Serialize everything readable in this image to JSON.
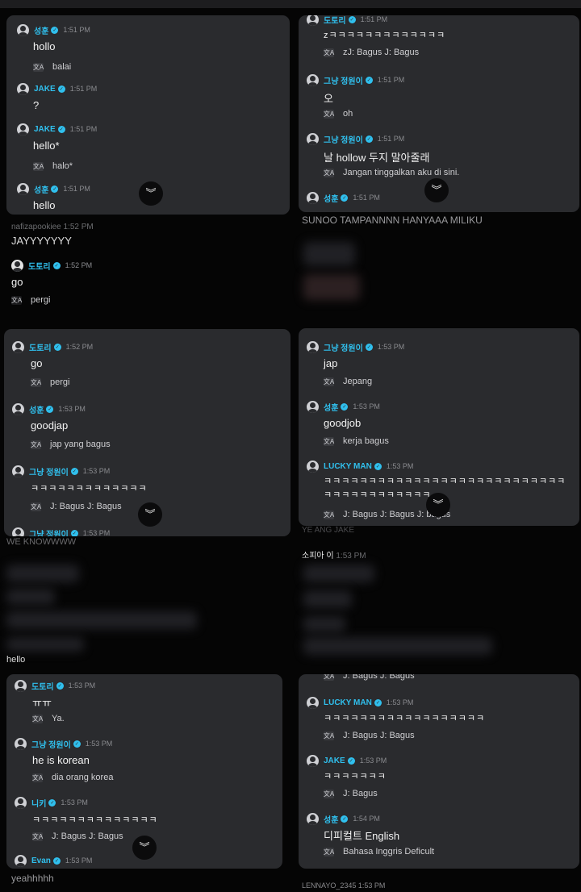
{
  "screenshots": {
    "s1": {
      "messages": [
        {
          "user": "성훈",
          "time": "1:51 PM",
          "text": "hollo",
          "translation": "balai"
        },
        {
          "user": "JAKE",
          "time": "1:51 PM",
          "text": "?"
        },
        {
          "user": "JAKE",
          "time": "1:51 PM",
          "text": "hello*",
          "translation": "halo*"
        },
        {
          "user": "성훈",
          "time": "1:51 PM",
          "text": "hello"
        }
      ],
      "below": {
        "username": "nafizapookiee",
        "time": "1:52 PM",
        "text": "JAYYYYYYY",
        "live_user": "도토리",
        "live_time": "1:52 PM",
        "live_text": "go",
        "live_translation": "pergi"
      }
    },
    "s2": {
      "messages": [
        {
          "user": "도토리",
          "time": "1:51 PM",
          "text": "zㅋㅋㅋㅋㅋㅋㅋㅋㅋㅋㅋㅋㅋ",
          "translation": "zJ: Bagus J: Bagus"
        },
        {
          "user": "그냥 정원이",
          "time": "1:51 PM",
          "text": "오",
          "translation": "oh"
        },
        {
          "user": "그냥 정원이",
          "time": "1:51 PM",
          "text": "날 hollow 두지 말아줄래",
          "translation": "Jangan tinggalkan aku di sini."
        },
        {
          "user": "성훈",
          "time": "1:51 PM"
        }
      ],
      "below": {
        "text": "SUNOO TAMPANNNN HANYAAA MILIKU"
      }
    },
    "s3": {
      "messages": [
        {
          "user": "도토리",
          "time": "1:52 PM",
          "text": "go",
          "translation": "pergi"
        },
        {
          "user": "성훈",
          "time": "1:53 PM",
          "text": "goodjap",
          "translation": "jap yang bagus"
        },
        {
          "user": "그냥 정원이",
          "time": "1:53 PM",
          "text": "ㅋㅋㅋㅋㅋㅋㅋㅋㅋㅋㅋㅋㅋ",
          "translation": "J: Bagus J: Bagus"
        },
        {
          "user": "그냥 정원이",
          "time": "1:53 PM"
        }
      ],
      "below": {
        "text": "WE KNOWWWW",
        "bottom_text": "hello"
      }
    },
    "s4": {
      "messages": [
        {
          "user": "그냥 정원이",
          "time": "1:53 PM",
          "text": "jap",
          "translation": "Jepang"
        },
        {
          "user": "성훈",
          "time": "1:53 PM",
          "text": "goodjob",
          "translation": "kerja bagus"
        },
        {
          "user": "LUCKY MAN",
          "time": "1:53 PM",
          "text": "ㅋㅋㅋㅋㅋㅋㅋㅋㅋㅋㅋㅋㅋㅋㅋㅋㅋㅋㅋㅋㅋㅋㅋㅋㅋㅋㅋㅋㅋㅋㅋㅋㅋㅋㅋㅋㅋㅋㅋ",
          "translation": "J: Bagus J: Bagus J: bagus"
        }
      ],
      "below": {
        "text": "YE ANG JAKE",
        "username": "소피아 이",
        "time": "1:53 PM"
      }
    },
    "s5": {
      "messages": [
        {
          "user": "도토리",
          "time": "1:53 PM",
          "text": "ㅠㅠ",
          "translation": "Ya."
        },
        {
          "user": "그냥 정원이",
          "time": "1:53 PM",
          "text": "he is korean",
          "translation": "dia orang korea"
        },
        {
          "user": "니키",
          "time": "1:53 PM",
          "text": "ㅋㅋㅋㅋㅋㅋㅋㅋㅋㅋㅋㅋㅋㅋ",
          "translation": "J: Bagus J: Bagus"
        },
        {
          "user": "Evan",
          "time": "1:53 PM"
        }
      ],
      "below": {
        "text": "yeahhhhh"
      }
    },
    "s6": {
      "top_translation": "J: Bagus J: Bagus",
      "messages": [
        {
          "user": "LUCKY MAN",
          "time": "1:53 PM",
          "text": "ㅋㅋㅋㅋㅋㅋㅋㅋㅋㅋㅋㅋㅋㅋㅋㅋㅋㅋ",
          "translation": "J: Bagus J: Bagus"
        },
        {
          "user": "JAKE",
          "time": "1:53 PM",
          "text": "ㅋㅋㅋㅋㅋㅋㅋ",
          "translation": "J: Bagus"
        },
        {
          "user": "성훈",
          "time": "1:54 PM",
          "text": "디피컬트 English",
          "translation": "Bahasa Inggris Deficult"
        }
      ],
      "below": {
        "username": "LENNAYO_2345",
        "time": "1:53 PM"
      }
    }
  },
  "icons": {
    "avatar": "avatar-icon",
    "verified": "verified-icon",
    "translate": "translate-icon",
    "scroll": "chevron-double-down-icon"
  },
  "colors": {
    "background": "#050505",
    "panel": "#2a2b2e",
    "username": "#30c0ee",
    "text": "#f2f2f2"
  }
}
